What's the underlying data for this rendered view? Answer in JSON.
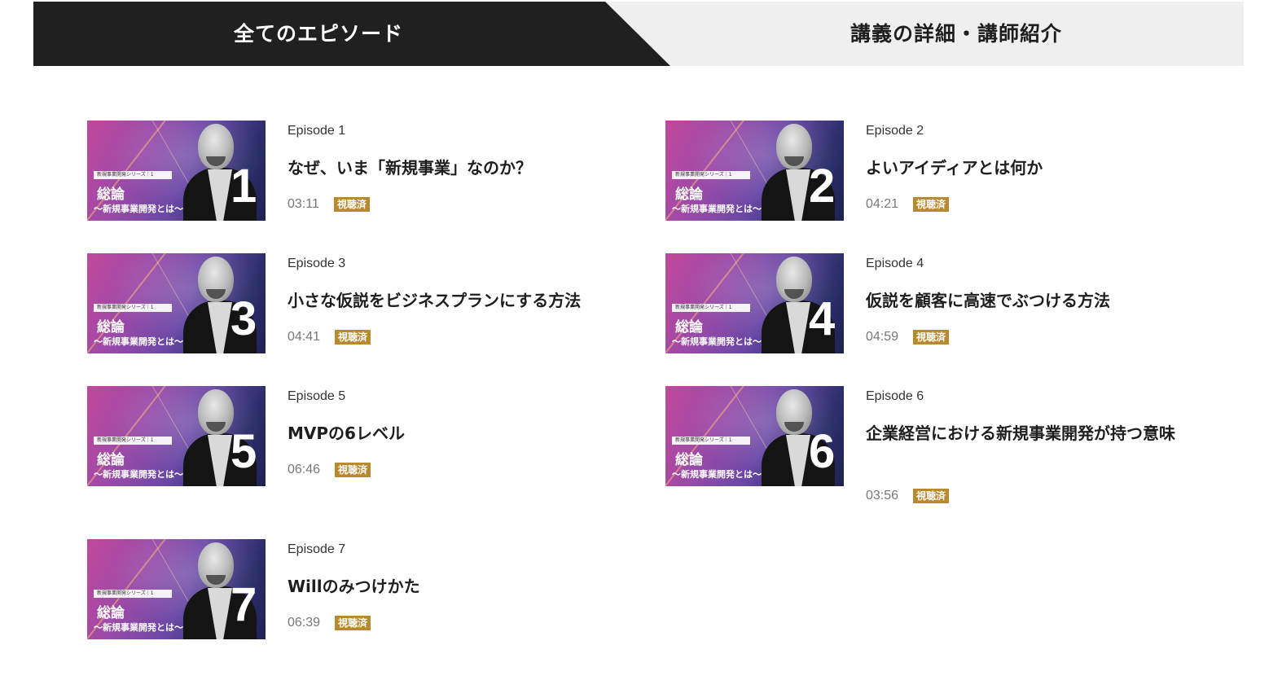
{
  "tabs": {
    "active_label": "全てのエピソード",
    "inactive_label": "講義の詳細・講師紹介"
  },
  "thumbnail": {
    "series_text": "新規事業開発シリーズ｜1",
    "title": "総論",
    "subtitle": "〜新規事業開発とは〜"
  },
  "episodes": [
    {
      "label": "Episode 1",
      "title": "なぜ、いま「新規事業」なのか？",
      "duration": "03:11",
      "badge": "視聴済",
      "number": "1"
    },
    {
      "label": "Episode 2",
      "title": "よいアイディアとは何か",
      "duration": "04:21",
      "badge": "視聴済",
      "number": "2"
    },
    {
      "label": "Episode 3",
      "title": "小さな仮説をビジネスプランにする方法",
      "duration": "04:41",
      "badge": "視聴済",
      "number": "3"
    },
    {
      "label": "Episode 4",
      "title": "仮説を顧客に高速でぶつける方法",
      "duration": "04:59",
      "badge": "視聴済",
      "number": "4"
    },
    {
      "label": "Episode 5",
      "title": "MVPの6レベル",
      "duration": "06:46",
      "badge": "視聴済",
      "number": "5"
    },
    {
      "label": "Episode 6",
      "title": "企業経営における新規事業開発が持つ意味",
      "duration": "03:56",
      "badge": "視聴済",
      "number": "6"
    },
    {
      "label": "Episode 7",
      "title": "Willのみつけかた",
      "duration": "06:39",
      "badge": "視聴済",
      "number": "7"
    }
  ]
}
